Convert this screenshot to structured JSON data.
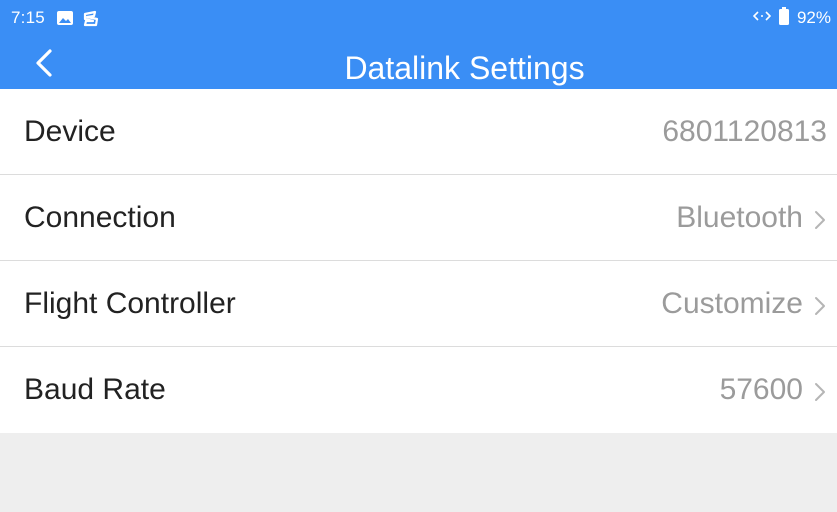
{
  "status_bar": {
    "time": "7:15",
    "icons": [
      "image-icon",
      "app-s-icon"
    ],
    "right_icons": [
      "data-transfer-icon",
      "battery-icon"
    ],
    "battery": "92%"
  },
  "header": {
    "title": "Datalink Settings",
    "back_icon": "chevron-left-icon"
  },
  "settings": [
    {
      "label": "Device",
      "value": "6801120813",
      "chevron": false
    },
    {
      "label": "Connection",
      "value": "Bluetooth",
      "chevron": true
    },
    {
      "label": "Flight Controller",
      "value": "Customize",
      "chevron": true
    },
    {
      "label": "Baud Rate",
      "value": "57600",
      "chevron": true
    }
  ],
  "colors": {
    "header_bg": "#3a8ef5",
    "page_bg": "#eeeeee",
    "label_text": "#222222",
    "value_text": "#9b9b9b",
    "divider": "#dcdcdc"
  }
}
